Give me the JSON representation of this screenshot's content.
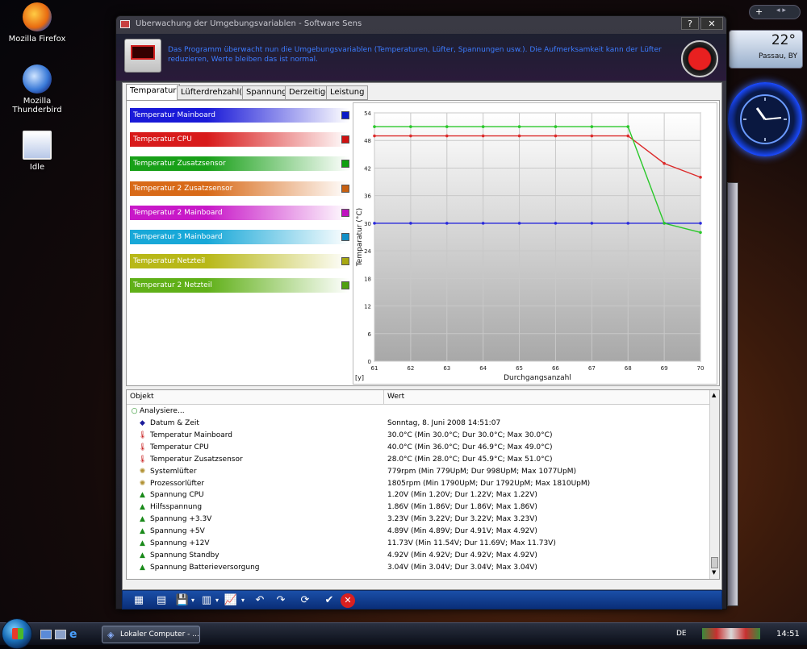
{
  "desktop": {
    "icons": [
      {
        "label": "Mozilla Firefox"
      },
      {
        "label": "Mozilla Thunderbird"
      },
      {
        "label": "Idle"
      }
    ]
  },
  "gadgets": {
    "weather": {
      "temp": "22°",
      "location": "Passau, BY"
    }
  },
  "window": {
    "title": "Überwachung der Umgebungsvariablen - Software Sensor",
    "header_text": "Das Programm überwacht nun die Umgebungsvariablen (Temperaturen, Lüfter, Spannungen usw.). Die Aufmerksamkeit kann der Lüfter reduzieren, Werte bleiben das ist normal.",
    "tabs": [
      "Temparatur",
      "Lüfterdrehzahl(en)",
      "Spannung",
      "Derzeitige",
      "Leistung"
    ],
    "active_tab": 0,
    "sensors": [
      {
        "label": "Temperatur Mainboard",
        "color": "#1a1ad8",
        "swatch": "#0a1ac8"
      },
      {
        "label": "Temperatur CPU",
        "color": "#d81a1a",
        "swatch": "#d01010"
      },
      {
        "label": "Temperatur Zusatzsensor",
        "color": "#18a018",
        "swatch": "#10a010"
      },
      {
        "label": "Temperatur 2 Zusatzsensor",
        "color": "#d86a18",
        "swatch": "#c86010"
      },
      {
        "label": "Temperatur 2 Mainboard",
        "color": "#c818c8",
        "swatch": "#c010c0"
      },
      {
        "label": "Temperatur 3 Mainboard",
        "color": "#18a8d8",
        "swatch": "#1090c8"
      },
      {
        "label": "Temperatur Netzteil",
        "color": "#b8b818",
        "swatch": "#a8a810"
      },
      {
        "label": "Temperatur 2 Netzteil",
        "color": "#60b018",
        "swatch": "#50a010"
      }
    ],
    "table": {
      "headers": [
        "Objekt",
        "Wert"
      ],
      "root": "Analysiere...",
      "rows": [
        {
          "icon": "diamond-icon",
          "name": "Datum & Zeit",
          "value": "Sonntag, 8. Juni 2008 14:51:07"
        },
        {
          "icon": "thermometer-icon",
          "name": "Temperatur Mainboard",
          "value": "30.0°C (Min 30.0°C; Dur 30.0°C; Max 30.0°C)"
        },
        {
          "icon": "thermometer-icon",
          "name": "Temperatur CPU",
          "value": "40.0°C (Min 36.0°C; Dur 46.9°C; Max 49.0°C)"
        },
        {
          "icon": "thermometer-icon",
          "name": "Temperatur Zusatzsensor",
          "value": "28.0°C (Min 28.0°C; Dur 45.9°C; Max 51.0°C)"
        },
        {
          "icon": "fan-icon",
          "name": "Systemlüfter",
          "value": "779rpm (Min 779UpM; Dur 998UpM; Max 1077UpM)"
        },
        {
          "icon": "fan-icon",
          "name": "Prozessorlüfter",
          "value": "1805rpm (Min 1790UpM; Dur 1792UpM; Max 1810UpM)"
        },
        {
          "icon": "voltage-icon",
          "name": "Spannung CPU",
          "value": "1.20V (Min 1.20V; Dur 1.22V; Max 1.22V)"
        },
        {
          "icon": "voltage-icon",
          "name": "Hilfsspannung",
          "value": "1.86V (Min 1.86V; Dur 1.86V; Max 1.86V)"
        },
        {
          "icon": "voltage-icon",
          "name": "Spannung +3.3V",
          "value": "3.23V (Min 3.22V; Dur 3.22V; Max 3.23V)"
        },
        {
          "icon": "voltage-icon",
          "name": "Spannung +5V",
          "value": "4.89V (Min 4.89V; Dur 4.91V; Max 4.92V)"
        },
        {
          "icon": "voltage-icon",
          "name": "Spannung +12V",
          "value": "11.73V (Min 11.54V; Dur 11.69V; Max 11.73V)"
        },
        {
          "icon": "voltage-icon",
          "name": "Spannung Standby",
          "value": "4.92V (Min 4.92V; Dur 4.92V; Max 4.92V)"
        },
        {
          "icon": "voltage-icon",
          "name": "Spannung Batterieversorgung",
          "value": "3.04V (Min 3.04V; Dur 3.04V; Max 3.04V)"
        }
      ]
    }
  },
  "chart_data": {
    "type": "line",
    "xlabel": "Durchgangsanzahl",
    "ylabel": "Temparatur (°C)",
    "x_corner_label": "[y]",
    "x": [
      61,
      62,
      63,
      64,
      65,
      66,
      67,
      68,
      69,
      70
    ],
    "ylim": [
      0,
      54
    ],
    "yticks": [
      0,
      6,
      12,
      18,
      24,
      30,
      36,
      42,
      48,
      54
    ],
    "grid": true,
    "series": [
      {
        "color": "#2a2adc",
        "values": [
          30,
          30,
          30,
          30,
          30,
          30,
          30,
          30,
          30,
          30
        ]
      },
      {
        "color": "#dc2a2a",
        "values": [
          49,
          49,
          49,
          49,
          49,
          49,
          49,
          49,
          43,
          40
        ]
      },
      {
        "color": "#2ac82a",
        "values": [
          51,
          51,
          51,
          51,
          51,
          51,
          51,
          51,
          30,
          28
        ]
      }
    ]
  },
  "taskbar": {
    "task": "Lokaler Computer - ...",
    "lang": "DE",
    "time": "14:51"
  }
}
